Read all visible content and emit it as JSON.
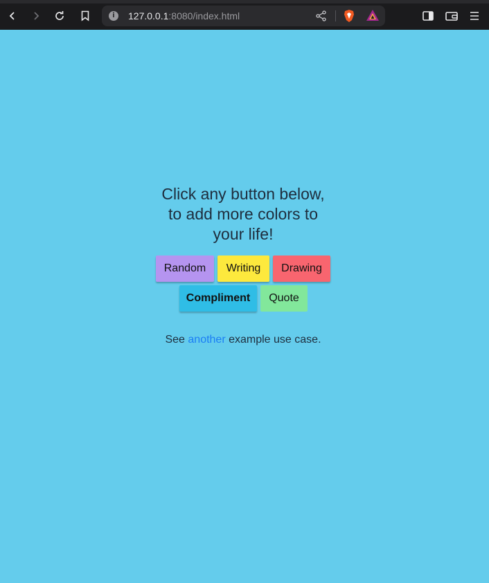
{
  "browser": {
    "url_host": "127.0.0.1",
    "url_rest": ":8080/index.html",
    "info_glyph": "i",
    "icons": [
      "back-icon",
      "forward-icon",
      "reload-icon",
      "bookmark-icon",
      "info-icon",
      "share-icon",
      "brave-shields-icon",
      "brave-rewards-icon",
      "sidebar-icon",
      "wallet-icon",
      "menu-icon"
    ]
  },
  "page": {
    "headline": "Click any button below, to add more colors to your life!",
    "buttons": {
      "random": "Random",
      "writing": "Writing",
      "drawing": "Drawing",
      "compliment": "Compliment",
      "quote": "Quote"
    },
    "footnote": {
      "prefix": "See ",
      "link": "another",
      "suffix": " example use case."
    }
  },
  "colors": {
    "background": "#64ccec",
    "random": "#b594f0",
    "writing": "#fde93d",
    "drawing": "#f8656f",
    "compliment": "#2fbde6",
    "quote": "#82e79b",
    "link": "#1b7ef5"
  }
}
